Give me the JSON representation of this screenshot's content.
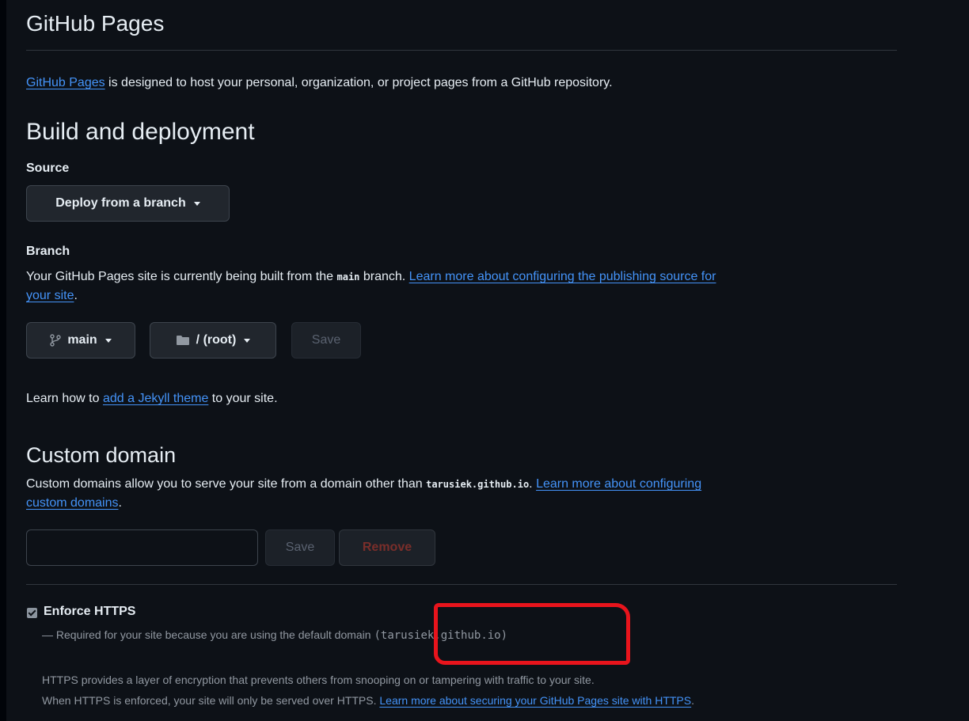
{
  "page": {
    "title": "GitHub Pages",
    "intro_link": "GitHub Pages",
    "intro_rest": " is designed to host your personal, organization, or project pages from a GitHub repository."
  },
  "build": {
    "heading": "Build and deployment",
    "source_label": "Source",
    "source_value": "Deploy from a branch",
    "branch_label": "Branch",
    "branch_desc_1": "Your GitHub Pages site is currently being built from the ",
    "branch_desc_code": "main",
    "branch_desc_2": " branch. ",
    "branch_desc_link_1": "Learn more about configuring the publishing source for",
    "branch_desc_link_2": "your site",
    "branch_desc_end": ".",
    "branch_value": "main",
    "folder_value": "/ (root)",
    "save_label": "Save",
    "jekyll_pre": "Learn how to ",
    "jekyll_link": "add a Jekyll theme",
    "jekyll_post": " to your site."
  },
  "custom_domain": {
    "heading": "Custom domain",
    "desc_1": "Custom domains allow you to serve your site from a domain other than ",
    "desc_code": "tarusiek.github.io",
    "desc_2": ". ",
    "desc_link_1": "Learn more about configuring",
    "desc_link_2": "custom domains",
    "desc_end": ".",
    "input_value": "",
    "save_label": "Save",
    "remove_label": "Remove"
  },
  "https": {
    "checkbox_checked": true,
    "label": "Enforce HTTPS",
    "required_text": "— Required for your site because you are using the default domain ",
    "required_code": "(tarusiek.github.io)",
    "desc_1": "HTTPS provides a layer of encryption that prevents others from snooping on or tampering with traffic to your site.",
    "desc_2_pre": "When HTTPS is enforced, your site will only be served over HTTPS. ",
    "desc_2_link": "Learn more about securing your GitHub Pages site with HTTPS",
    "desc_2_end": "."
  },
  "colors": {
    "background": "#0d1117",
    "link": "#4493f8",
    "annotation": "#e8141c"
  },
  "icons": {
    "branch": "git-branch-icon",
    "folder": "folder-icon",
    "caret": "triangle-down-icon",
    "check": "check-icon"
  }
}
